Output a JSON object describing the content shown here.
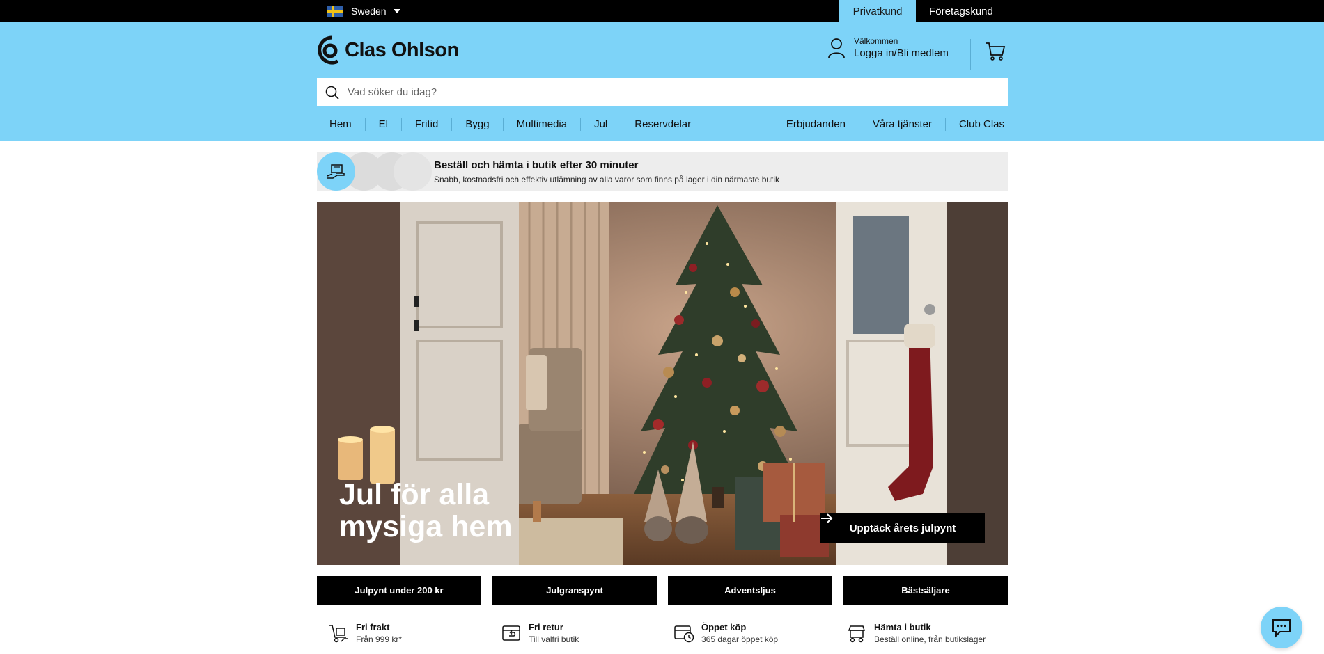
{
  "topbar": {
    "country": "Sweden",
    "segments": {
      "private": "Privatkund",
      "business": "Företagskund"
    }
  },
  "header": {
    "brand": "Clas Ohlson",
    "account": {
      "greeting": "Välkommen",
      "login": "Logga in/Bli medlem"
    },
    "search_placeholder": "Vad söker du idag?"
  },
  "nav": {
    "left": [
      "Hem",
      "El",
      "Fritid",
      "Bygg",
      "Multimedia",
      "Jul",
      "Reservdelar"
    ],
    "right": [
      "Erbjudanden",
      "Våra tjänster",
      "Club Clas"
    ]
  },
  "info_banner": {
    "title": "Beställ och hämta i butik efter 30 minuter",
    "subtitle": "Snabb, kostnadsfri och effektiv utlämning av alla varor som finns på lager i din närmaste butik"
  },
  "hero": {
    "title_line1": "Jul för alla",
    "title_line2": "mysiga hem",
    "cta": "Upptäck årets julpynt"
  },
  "categories": [
    "Julpynt under 200 kr",
    "Julgranspynt",
    "Adventsljus",
    "Bästsäljare"
  ],
  "usps": [
    {
      "icon": "delivery-truck-icon",
      "title": "Fri frakt",
      "sub": "Från 999 kr*"
    },
    {
      "icon": "return-box-icon",
      "title": "Fri retur",
      "sub": "Till valfri butik"
    },
    {
      "icon": "clock-box-icon",
      "title": "Öppet köp",
      "sub": "365 dagar öppet köp"
    },
    {
      "icon": "pickup-store-icon",
      "title": "Hämta i butik",
      "sub": "Beställ online, från butikslager"
    }
  ],
  "colors": {
    "brand_blue": "#7dd3f8",
    "black": "#000000",
    "banner_grey": "#ededed"
  }
}
